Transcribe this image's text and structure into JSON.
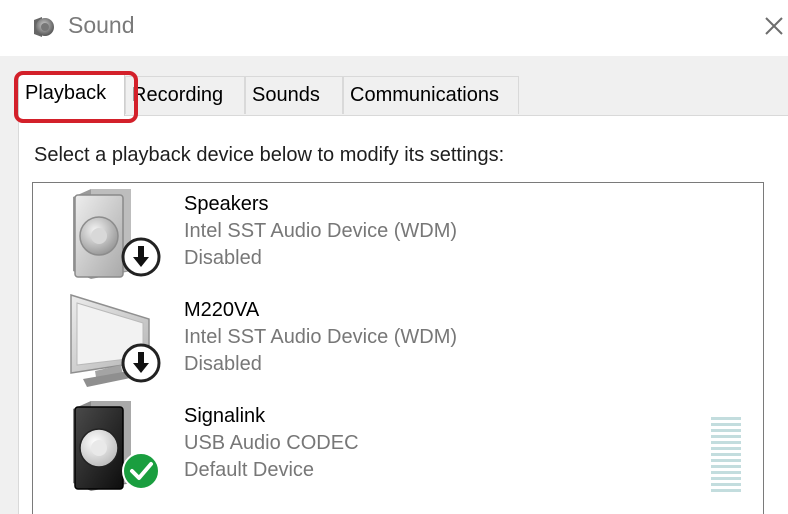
{
  "window": {
    "title": "Sound",
    "icon": "speaker-icon",
    "close_icon": "close-icon"
  },
  "tabs": [
    {
      "label": "Playback",
      "selected": true
    },
    {
      "label": "Recording",
      "selected": false
    },
    {
      "label": "Sounds",
      "selected": false
    },
    {
      "label": "Communications",
      "selected": false
    }
  ],
  "highlight_color": "#d3202a",
  "instruction": "Select a playback device below to modify its settings:",
  "devices": [
    {
      "name": "Speakers",
      "description": "Intel SST Audio Device (WDM)",
      "status": "Disabled",
      "icon": "speaker-icon",
      "badge": "disabled-arrow-badge"
    },
    {
      "name": "M220VA",
      "description": "Intel SST Audio Device (WDM)",
      "status": "Disabled",
      "icon": "monitor-icon",
      "badge": "disabled-arrow-badge"
    },
    {
      "name": "Signalink",
      "description": "USB Audio CODEC",
      "status": "Default Device",
      "icon": "speaker-icon",
      "badge": "default-check-badge",
      "level_meter": true
    }
  ],
  "colors": {
    "check_badge": "#1a9e3f",
    "meter": "#c3ddde"
  }
}
